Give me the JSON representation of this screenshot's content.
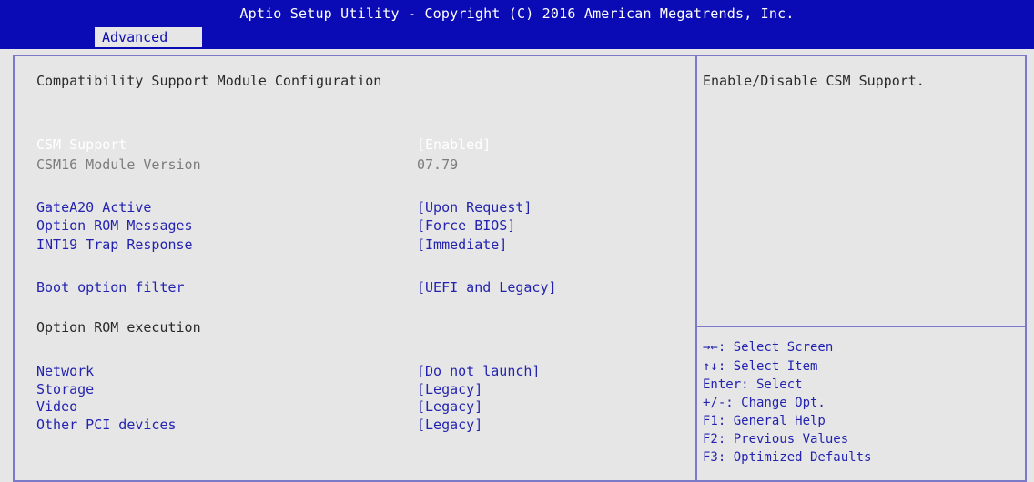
{
  "header": {
    "title": "Aptio Setup Utility - Copyright (C) 2016 American Megatrends, Inc.",
    "tab": "Advanced"
  },
  "page": {
    "heading": "Compatibility Support Module Configuration",
    "section_option_rom": "Option ROM execution"
  },
  "items": {
    "csm_support": {
      "label": "CSM Support",
      "value": "[Enabled]"
    },
    "csm16_version": {
      "label": "CSM16 Module Version",
      "value": "07.79"
    },
    "gatea20": {
      "label": "GateA20 Active",
      "value": "[Upon Request]"
    },
    "option_rom_messages": {
      "label": "Option ROM Messages",
      "value": "[Force BIOS]"
    },
    "int19": {
      "label": "INT19 Trap Response",
      "value": "[Immediate]"
    },
    "boot_filter": {
      "label": "Boot option filter",
      "value": "[UEFI and Legacy]"
    },
    "network": {
      "label": "Network",
      "value": "[Do not launch]"
    },
    "storage": {
      "label": "Storage",
      "value": "[Legacy]"
    },
    "video": {
      "label": "Video",
      "value": "[Legacy]"
    },
    "other_pci": {
      "label": "Other PCI devices",
      "value": "[Legacy]"
    }
  },
  "help": {
    "text": "Enable/Disable CSM Support."
  },
  "legend": [
    "→←: Select Screen",
    "↑↓: Select Item",
    "Enter: Select",
    "+/-: Change Opt.",
    "F1: General Help",
    "F2: Previous Values",
    "F3: Optimized Defaults"
  ],
  "colors": {
    "header_bg": "#0b0bb5",
    "panel_bg": "#e6e6e6",
    "border": "#7a7ac8",
    "item_text": "#2323b0",
    "disabled_text": "#7c7c7c",
    "selected_text": "#ffffff"
  }
}
